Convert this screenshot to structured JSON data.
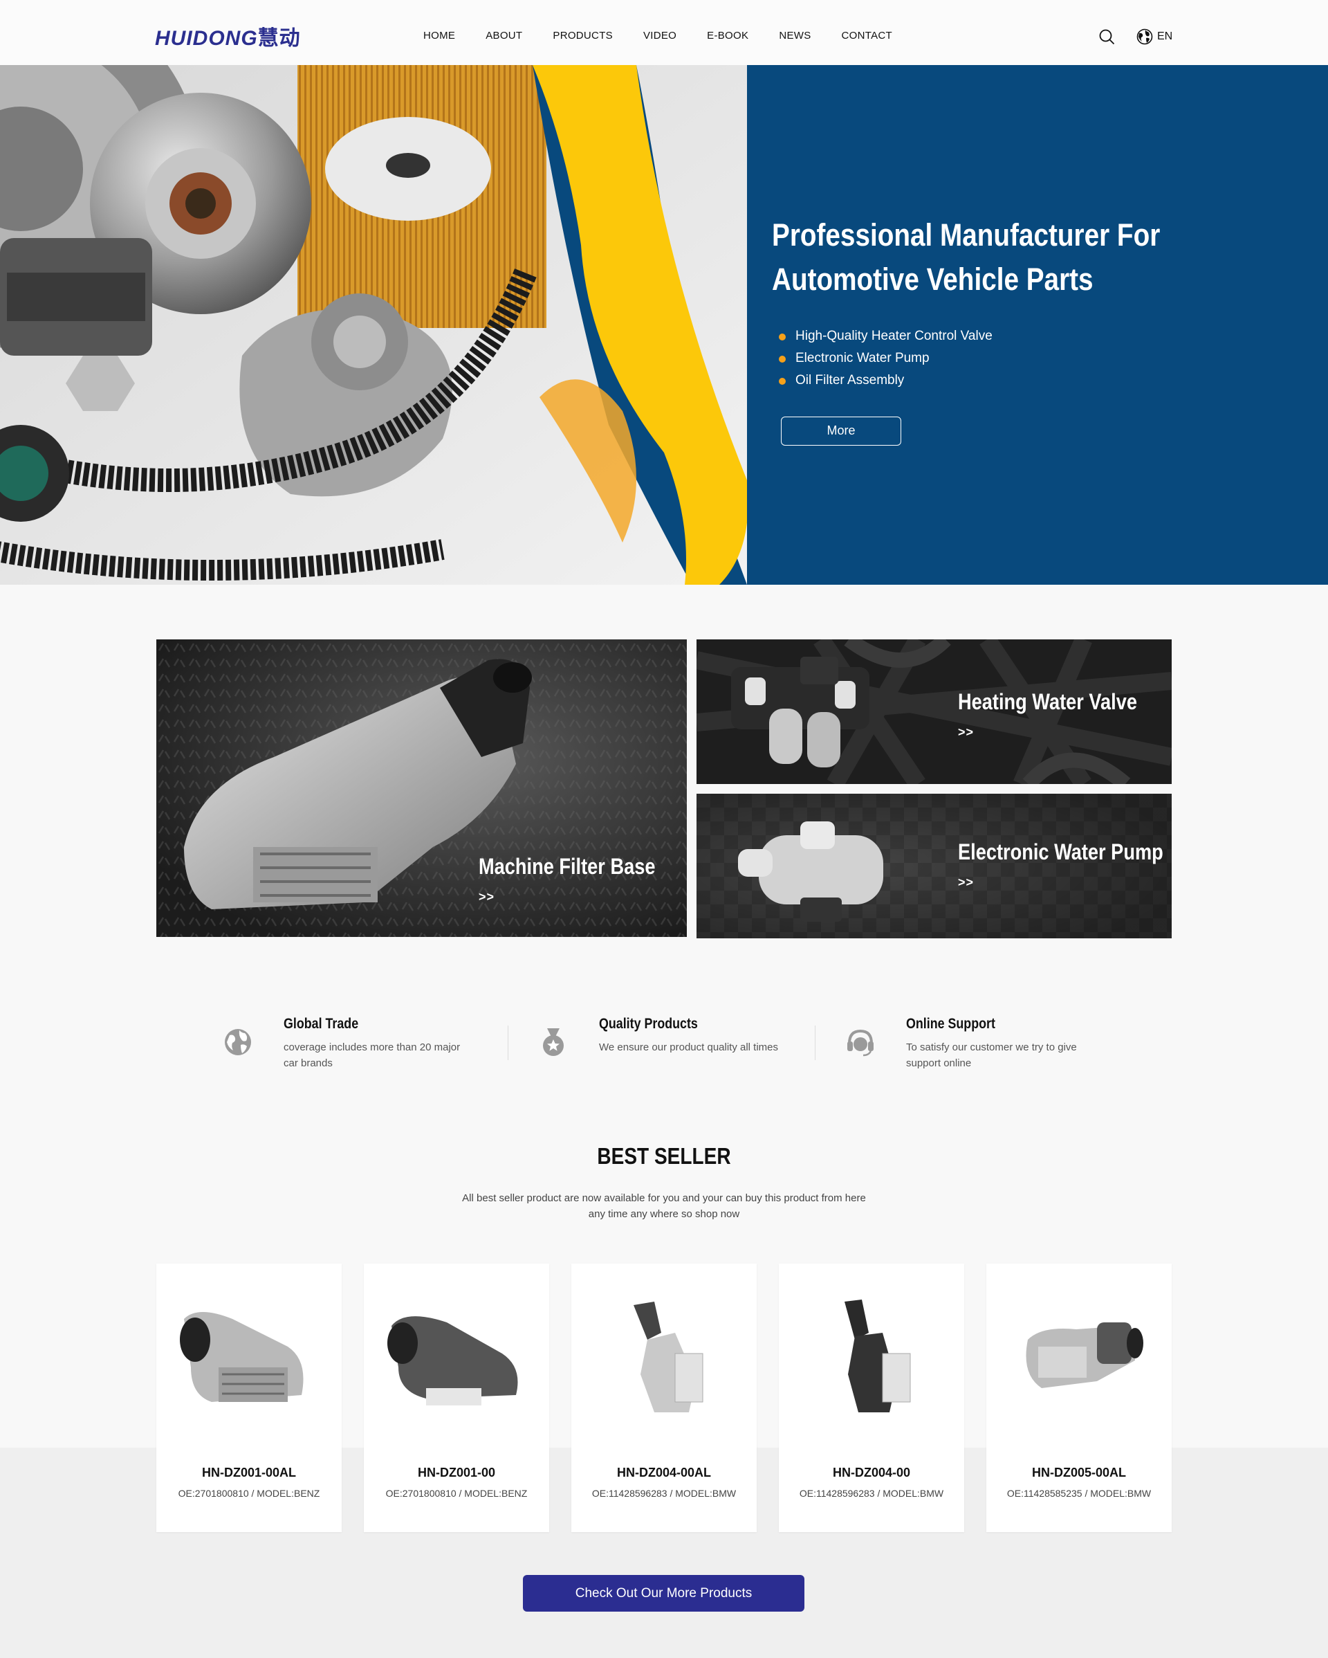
{
  "header": {
    "logo_text": "HUIDONG",
    "logo_cn": "慧动",
    "nav": [
      "HOME",
      "ABOUT",
      "PRODUCTS",
      "VIDEO",
      "E-BOOK",
      "NEWS",
      "CONTACT"
    ],
    "lang": "EN"
  },
  "hero": {
    "title": "Professional Manufacturer For Automotive Vehicle Parts",
    "bullets": [
      "High-Quality Heater Control Valve",
      "Electronic Water Pump",
      "Oil Filter Assembly"
    ],
    "button": "More",
    "colors": {
      "background": "#08497d",
      "accent": "#fcc80a",
      "bullet": "#f6a11a"
    }
  },
  "categories": [
    {
      "label": "Machine Filter Base",
      "arrow": ">>"
    },
    {
      "label": "Heating Water Valve",
      "arrow": ">>"
    },
    {
      "label": "Electronic Water Pump",
      "arrow": ">>"
    }
  ],
  "features": [
    {
      "icon": "globe-icon",
      "title": "Global Trade",
      "desc": "coverage includes more than 20 major car brands"
    },
    {
      "icon": "medal-icon",
      "title": "Quality Products",
      "desc": "We ensure our product quality all times"
    },
    {
      "icon": "headset-icon",
      "title": "Online Support",
      "desc": "To satisfy our customer we try to give support online"
    }
  ],
  "best_seller": {
    "title": "BEST SELLER",
    "subtitle": "All best seller product are now available for you and your can buy this product from here any time any where so shop now",
    "products": [
      {
        "name": "HN-DZ001-00AL",
        "info": "OE:2701800810 / MODEL:BENZ"
      },
      {
        "name": "HN-DZ001-00",
        "info": "OE:2701800810 / MODEL:BENZ"
      },
      {
        "name": "HN-DZ004-00AL",
        "info": "OE:11428596283 / MODEL:BMW"
      },
      {
        "name": "HN-DZ004-00",
        "info": "OE:11428596283 / MODEL:BMW"
      },
      {
        "name": "HN-DZ005-00AL",
        "info": "OE:11428585235 / MODEL:BMW"
      }
    ],
    "button": "Check Out Our More Products",
    "button_color": "#2b2d91"
  }
}
